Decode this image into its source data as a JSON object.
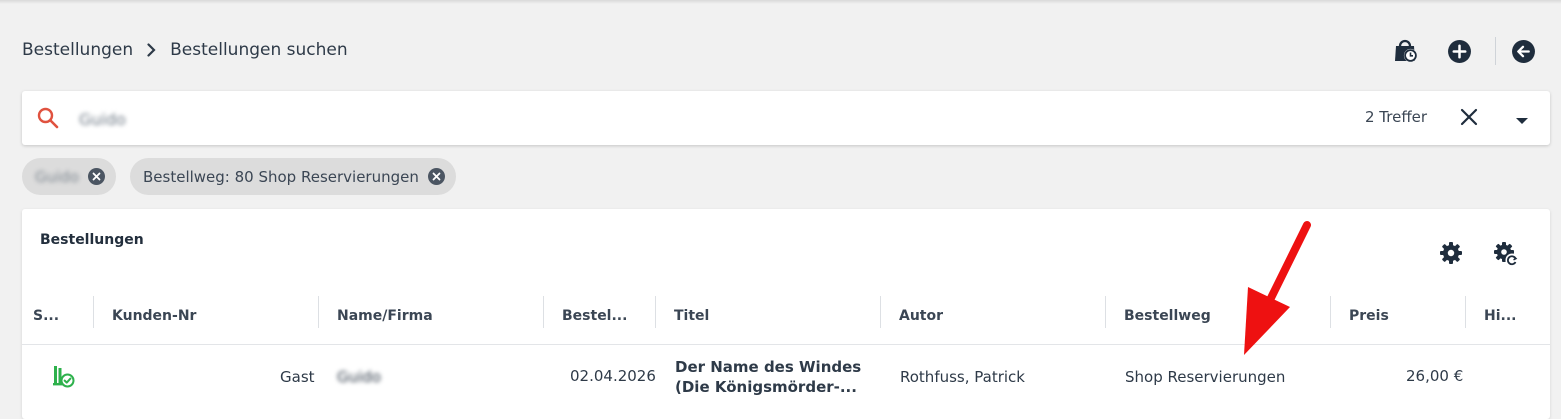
{
  "breadcrumb": {
    "root": "Bestellungen",
    "current": "Bestellungen suchen"
  },
  "header_icons": [
    "shopping-bag-clock-icon",
    "plus-circle-icon",
    "arrow-left-circle-icon"
  ],
  "search": {
    "query": "Guido",
    "hits": "2 Treffer"
  },
  "filters": [
    {
      "label": "Guido"
    },
    {
      "label": "Bestellweg: 80 Shop Reservierungen"
    }
  ],
  "table": {
    "title": "Bestellungen",
    "columns": [
      "S...",
      "Kunden-Nr",
      "Name/Firma",
      "Bestel...",
      "Titel",
      "Autor",
      "Bestellweg",
      "Preis",
      "Hi..."
    ],
    "rows": [
      {
        "status_icon": "books-check-icon",
        "kunden_nr": "Gast",
        "name": "Guido",
        "datum": "02.04.2026",
        "titel_line1": "Der Name des Windes",
        "titel_line2": "(Die Königsmörder-...",
        "autor": "Rothfuss, Patrick",
        "bestellweg": "Shop Reservierungen",
        "preis": "26,00 €"
      }
    ]
  },
  "colors": {
    "accent_search": "#e0523f",
    "status_green": "#2eb14c",
    "annotation_arrow": "#ee1111"
  }
}
